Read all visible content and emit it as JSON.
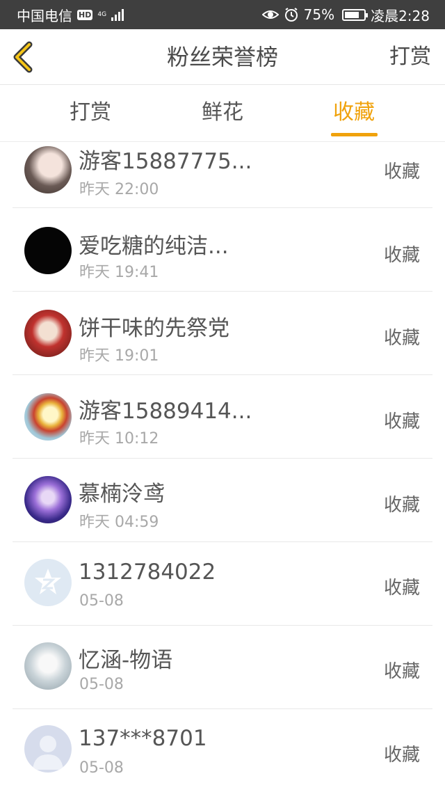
{
  "status_bar": {
    "carrier": "中国电信",
    "hd": "HD",
    "network": "4G",
    "battery_percent": "75%",
    "battery_level": 0.75,
    "time": "凌晨2:28",
    "icons": [
      "eye-icon",
      "alarm-icon",
      "battery-icon",
      "signal-icon"
    ]
  },
  "header": {
    "title": "粉丝荣誉榜",
    "action": "打赏",
    "back_icon": "chevron-left-icon"
  },
  "tabs": [
    {
      "label": "打赏",
      "active": false
    },
    {
      "label": "鲜花",
      "active": false
    },
    {
      "label": "收藏",
      "active": true
    }
  ],
  "colors": {
    "accent": "#f0a20c",
    "status_bar_bg": "#3f3f3f"
  },
  "fans": [
    {
      "name": "游客15887775...",
      "time": "昨天 22:00",
      "action": "收藏",
      "avatar": "anime-girl-avatar"
    },
    {
      "name": "爱吃糖的纯洁...",
      "time": "昨天 19:41",
      "action": "收藏",
      "avatar": "black-avatar"
    },
    {
      "name": "饼干味的先祭党",
      "time": "昨天 19:01",
      "action": "收藏",
      "avatar": "red-anime-avatar"
    },
    {
      "name": "游客15889414...",
      "time": "昨天 10:12",
      "action": "收藏",
      "avatar": "cartoon-duck-avatar"
    },
    {
      "name": "慕楠泠鸢",
      "time": "昨天 04:59",
      "action": "收藏",
      "avatar": "purple-anime-avatar"
    },
    {
      "name": "1312784022",
      "time": "05-08",
      "action": "收藏",
      "avatar": "qq-logo-avatar"
    },
    {
      "name": "忆涵-物语",
      "time": "05-08",
      "action": "收藏",
      "avatar": "pale-anime-avatar"
    },
    {
      "name": "137***8701",
      "time": "05-08",
      "action": "收藏",
      "avatar": "default-user-avatar"
    }
  ]
}
